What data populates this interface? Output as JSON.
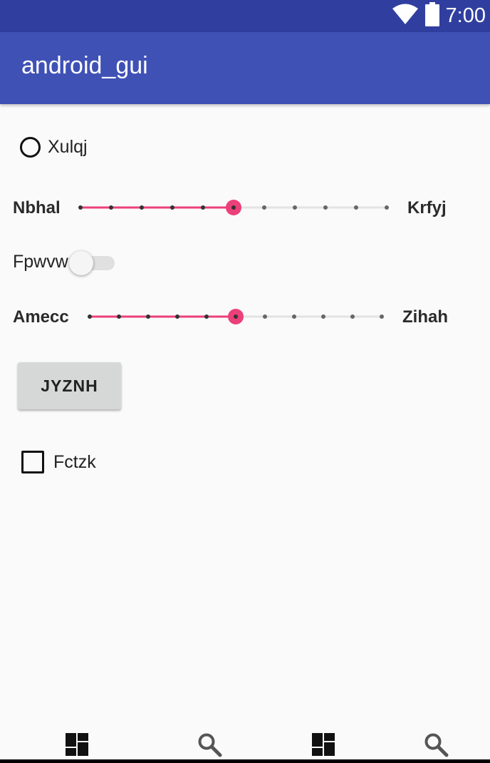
{
  "status_bar": {
    "time": "7:00",
    "icons": [
      "wifi-icon",
      "battery-icon"
    ]
  },
  "app_bar": {
    "title": "android_gui"
  },
  "radio": {
    "label": "Xulqj",
    "checked": false
  },
  "seekbar1": {
    "left_label": "Nbhal",
    "right_label": "Krfyj",
    "max": 10,
    "value": 5
  },
  "switch": {
    "label": "Fpwvw",
    "on": false
  },
  "seekbar2": {
    "left_label": "Amecc",
    "right_label": "Zihah",
    "max": 10,
    "value": 5
  },
  "button": {
    "label": "JYZNH"
  },
  "checkbox": {
    "label": "Fctzk",
    "checked": false
  },
  "bottom_nav": {
    "items": [
      "dashboard-icon",
      "search-icon",
      "dashboard-icon",
      "search-icon"
    ]
  },
  "colors": {
    "status_bar": "#303f9f",
    "app_bar": "#3f51b5",
    "accent": "#ec407a",
    "background": "#fafafa"
  }
}
